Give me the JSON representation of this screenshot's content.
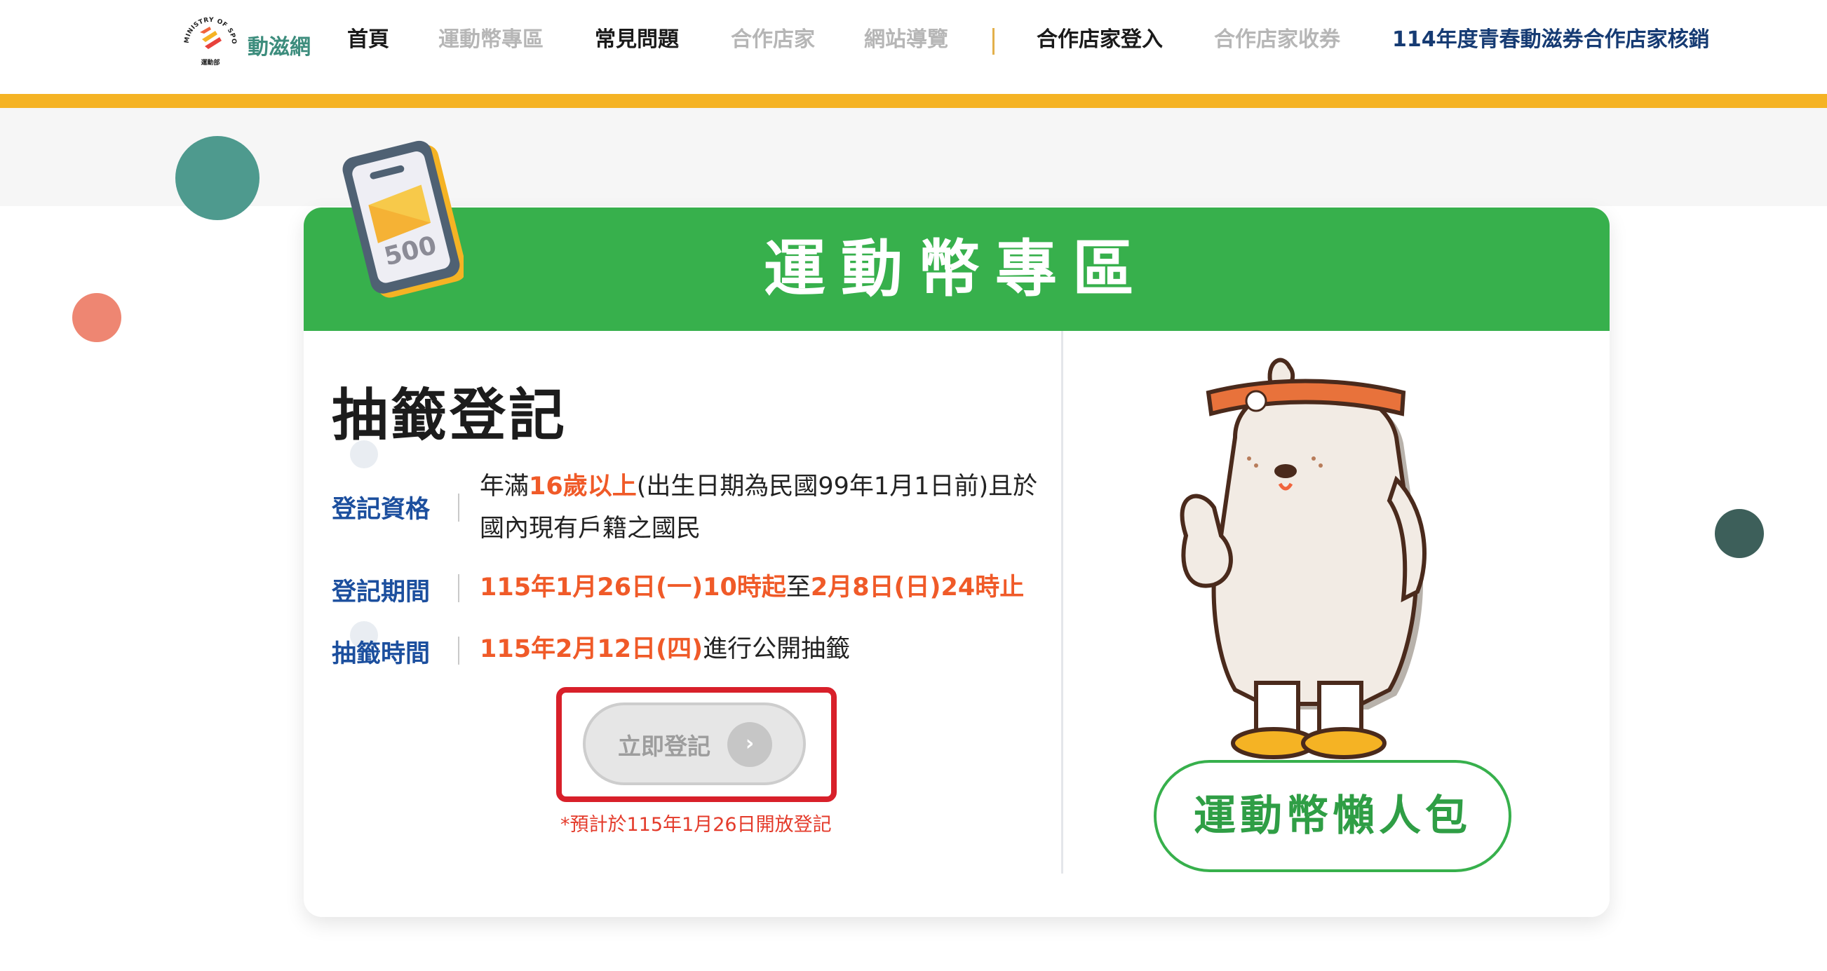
{
  "header": {
    "logo_ring_text": "MINISTRY OF SPORTS",
    "logo_dept_text": "運動部",
    "brand": "動滋網",
    "nav": {
      "home": "首頁",
      "coin_zone": "運動幣專區",
      "faq": "常見問題",
      "partners": "合作店家",
      "sitemap": "網站導覽",
      "partner_login": "合作店家登入",
      "partner_collect": "合作店家收券",
      "youth_coupon": "114年度青春動滋券合作店家核銷"
    }
  },
  "colors": {
    "green": "#37b04c",
    "gold": "#f5b324",
    "navy": "#163b73",
    "label_blue": "#1c4f9e",
    "highlight_orange": "#f05a28",
    "alert_red": "#d8202a"
  },
  "card": {
    "title": "運動幣專區",
    "coin_amount": "500",
    "section_title": "抽籤登記",
    "eligibility": {
      "label": "登記資格",
      "prefix": "年滿",
      "age": "16歲以上",
      "suffix": "(出生日期為民國99年1月1日前)且於",
      "line2": "國內現有戶籍之國民"
    },
    "period": {
      "label": "登記期間",
      "start": "115年1月26日(一)10時起",
      "mid": "至",
      "end": "2月8日(日)24時止"
    },
    "draw": {
      "label": "抽籤時間",
      "date": "115年2月12日(四)",
      "suffix": "進行公開抽籤"
    },
    "register_button": "立即登記",
    "register_note": "*預計於115年1月26日開放登記",
    "lazy_pack_button": "運動幣懶人包"
  }
}
